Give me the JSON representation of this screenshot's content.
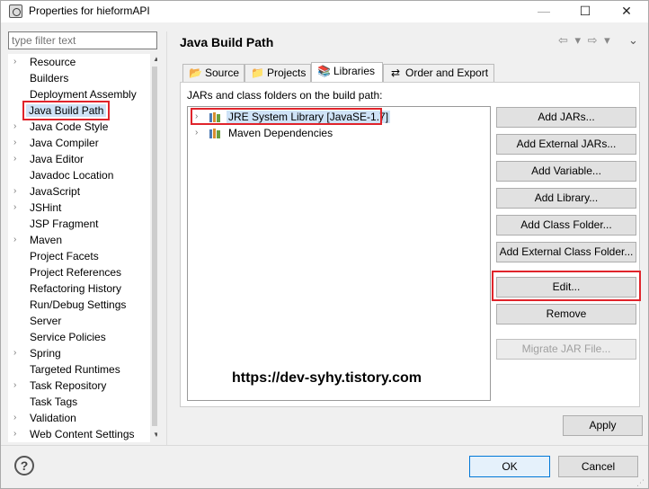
{
  "window": {
    "title": "Properties for hieformAPI"
  },
  "filter": {
    "placeholder": "type filter text"
  },
  "tree": {
    "items": [
      {
        "label": "Resource",
        "expandable": true
      },
      {
        "label": "Builders",
        "expandable": false
      },
      {
        "label": "Deployment Assembly",
        "expandable": false
      },
      {
        "label": "Java Build Path",
        "expandable": false,
        "selected": true
      },
      {
        "label": "Java Code Style",
        "expandable": true
      },
      {
        "label": "Java Compiler",
        "expandable": true
      },
      {
        "label": "Java Editor",
        "expandable": true
      },
      {
        "label": "Javadoc Location",
        "expandable": false
      },
      {
        "label": "JavaScript",
        "expandable": true
      },
      {
        "label": "JSHint",
        "expandable": true
      },
      {
        "label": "JSP Fragment",
        "expandable": false
      },
      {
        "label": "Maven",
        "expandable": true
      },
      {
        "label": "Project Facets",
        "expandable": false
      },
      {
        "label": "Project References",
        "expandable": false
      },
      {
        "label": "Refactoring History",
        "expandable": false
      },
      {
        "label": "Run/Debug Settings",
        "expandable": false
      },
      {
        "label": "Server",
        "expandable": false
      },
      {
        "label": "Service Policies",
        "expandable": false
      },
      {
        "label": "Spring",
        "expandable": true
      },
      {
        "label": "Targeted Runtimes",
        "expandable": false
      },
      {
        "label": "Task Repository",
        "expandable": true
      },
      {
        "label": "Task Tags",
        "expandable": false
      },
      {
        "label": "Validation",
        "expandable": true
      },
      {
        "label": "Web Content Settings",
        "expandable": true
      }
    ]
  },
  "page": {
    "title": "Java Build Path",
    "tabs": [
      {
        "label": "Source",
        "icon": "source-folder-icon"
      },
      {
        "label": "Projects",
        "icon": "projects-folder-icon"
      },
      {
        "label": "Libraries",
        "icon": "libraries-icon",
        "active": true
      },
      {
        "label": "Order and Export",
        "icon": "order-export-icon"
      }
    ],
    "jars_label": "JARs and class folders on the build path:",
    "jars": [
      {
        "label": "JRE System Library [JavaSE-1.7]",
        "selected": true
      },
      {
        "label": "Maven Dependencies"
      }
    ],
    "buttons": {
      "add_jars": "Add JARs...",
      "add_external_jars": "Add External JARs...",
      "add_variable": "Add Variable...",
      "add_library": "Add Library...",
      "add_class_folder": "Add Class Folder...",
      "add_external_class_folder": "Add External Class Folder...",
      "edit": "Edit...",
      "remove": "Remove",
      "migrate_jar": "Migrate JAR File..."
    },
    "watermark": "https://dev-syhy.tistory.com"
  },
  "footer": {
    "apply": "Apply",
    "ok": "OK",
    "cancel": "Cancel"
  },
  "colors": {
    "highlight_red": "#e0242b",
    "selection_blue": "#cfe3f7",
    "ok_border": "#0078d7"
  }
}
